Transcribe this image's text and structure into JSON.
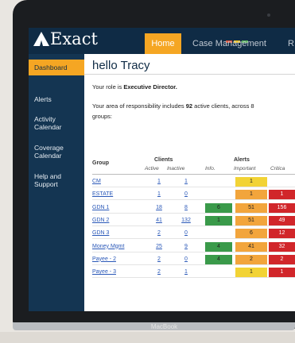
{
  "app": {
    "logo_text": "Exact"
  },
  "nav": {
    "tabs": [
      {
        "label": "Home",
        "active": true
      },
      {
        "label": "Case Management",
        "active": false
      },
      {
        "label": "R",
        "active": false
      }
    ]
  },
  "sidebar": {
    "items": [
      {
        "label": "Dashboard",
        "active": true
      },
      {
        "label": "Alerts"
      },
      {
        "label": "Activity Calendar"
      },
      {
        "label": "Coverage Calendar"
      },
      {
        "label": "Help and Support"
      }
    ]
  },
  "main": {
    "greeting": "hello Tracy",
    "role_prefix": "Your role is ",
    "role_value": "Executive Director.",
    "area_line1_prefix": "Your area of responsibility includes ",
    "area_count": "92",
    "area_line1_suffix": " active clients, across 8",
    "area_line2": "groups:"
  },
  "table": {
    "headers": {
      "group": "Group",
      "clients": "Clients",
      "active": "Active",
      "inactive": "Inactive",
      "alerts": "Alerts",
      "info": "Info.",
      "important": "Important",
      "critical": "Critica"
    },
    "rows": [
      {
        "group": "CM",
        "active": "1",
        "inactive": "1",
        "info": "",
        "important": "1",
        "critical": ""
      },
      {
        "group": "ESTATE",
        "active": "1",
        "inactive": "0",
        "info": "",
        "important": "1",
        "critical": "1"
      },
      {
        "group": "GDN 1",
        "active": "18",
        "inactive": "8",
        "info": "6",
        "important": "51",
        "critical": "156"
      },
      {
        "group": "GDN 2",
        "active": "41",
        "inactive": "132",
        "info": "1",
        "important": "51",
        "critical": "49"
      },
      {
        "group": "GDN 3",
        "active": "2",
        "inactive": "0",
        "info": "",
        "important": "6",
        "critical": "12"
      },
      {
        "group": "Money Mgmt",
        "active": "25",
        "inactive": "9",
        "info": "4",
        "important": "41",
        "critical": "32"
      },
      {
        "group": "Payee - 2",
        "active": "2",
        "inactive": "0",
        "info": "4",
        "important": "2",
        "critical": "2"
      },
      {
        "group": "Payee - 3",
        "active": "2",
        "inactive": "1",
        "info": "",
        "important": "1",
        "critical": "1"
      }
    ]
  },
  "device": {
    "brand": "MacBook"
  },
  "colors": {
    "topbar": "#0f2b45",
    "accent": "#f5a623",
    "sidebar": "#143552",
    "info_green": "#3a9a4a",
    "important_yellow": "#f2d335",
    "important_orange": "#f2a53c",
    "critical_red": "#d1262a"
  }
}
